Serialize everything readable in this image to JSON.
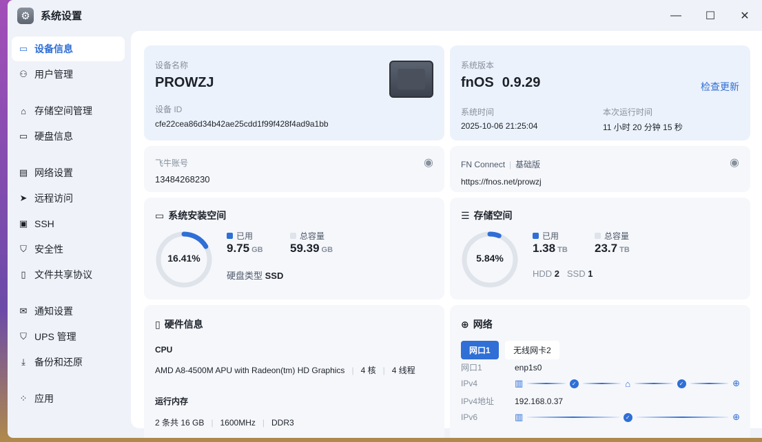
{
  "window": {
    "title": "系统设置"
  },
  "sidebar": {
    "items": [
      {
        "label": "设备信息",
        "icon": "drive-icon"
      },
      {
        "label": "用户管理",
        "icon": "users-icon"
      },
      {
        "label": "存储空间管理",
        "icon": "storage-icon"
      },
      {
        "label": "硬盘信息",
        "icon": "disk-icon"
      },
      {
        "label": "网络设置",
        "icon": "network-icon"
      },
      {
        "label": "远程访问",
        "icon": "send-icon"
      },
      {
        "label": "SSH",
        "icon": "terminal-icon"
      },
      {
        "label": "安全性",
        "icon": "shield-icon"
      },
      {
        "label": "文件共享协议",
        "icon": "file-icon"
      },
      {
        "label": "通知设置",
        "icon": "mail-icon"
      },
      {
        "label": "UPS 管理",
        "icon": "shield-icon"
      },
      {
        "label": "备份和还原",
        "icon": "download-icon"
      },
      {
        "label": "应用",
        "icon": "apps-icon"
      }
    ]
  },
  "device": {
    "name_label": "设备名称",
    "name": "PROWZJ",
    "id_label": "设备 ID",
    "id": "cfe22cea86d34b42ae25cdd1f99f428f4ad9a1bb"
  },
  "system": {
    "version_label": "系统版本",
    "os": "fnOS",
    "version": "0.9.29",
    "check_update": "检查更新",
    "time_label": "系统时间",
    "time": "2025-10-06 21:25:04",
    "uptime_label": "本次运行时间",
    "uptime": "11 小时 20 分钟 15 秒"
  },
  "account": {
    "label": "飞牛账号",
    "value": "13484268230"
  },
  "connect": {
    "label": "FN Connect",
    "tier": "基础版",
    "url": "https://fnos.net/prowzj"
  },
  "sys_space": {
    "title": "系统安装空间",
    "percent": "16.41%",
    "fraction": 0.1641,
    "used_label": "已用",
    "used": "9.75",
    "used_unit": "GB",
    "total_label": "总容量",
    "total": "59.39",
    "total_unit": "GB",
    "disk_type_label": "硬盘类型",
    "disk_type": "SSD"
  },
  "storage": {
    "title": "存储空间",
    "percent": "5.84%",
    "fraction": 0.0584,
    "used_label": "已用",
    "used": "1.38",
    "used_unit": "TB",
    "total_label": "总容量",
    "total": "23.7",
    "total_unit": "TB",
    "hdd_label": "HDD",
    "hdd": "2",
    "ssd_label": "SSD",
    "ssd": "1"
  },
  "hardware": {
    "title": "硬件信息",
    "cpu_label": "CPU",
    "cpu": "AMD A8-4500M APU with Radeon(tm) HD Graphics",
    "cores": "4 核",
    "threads": "4 线程",
    "mem_label": "运行内存",
    "mem": "2 条共 16 GB",
    "mem_freq": "1600MHz",
    "mem_type": "DDR3"
  },
  "network": {
    "title": "网络",
    "tabs": [
      "网口1",
      "无线网卡2"
    ],
    "port_label": "网口1",
    "port": "enp1s0",
    "ipv4_label": "IPv4",
    "ipv4_addr_label": "IPv4地址",
    "ipv4_addr": "192.168.0.37",
    "ipv6_label": "IPv6"
  },
  "colors": {
    "accent": "#2f6fd6"
  }
}
